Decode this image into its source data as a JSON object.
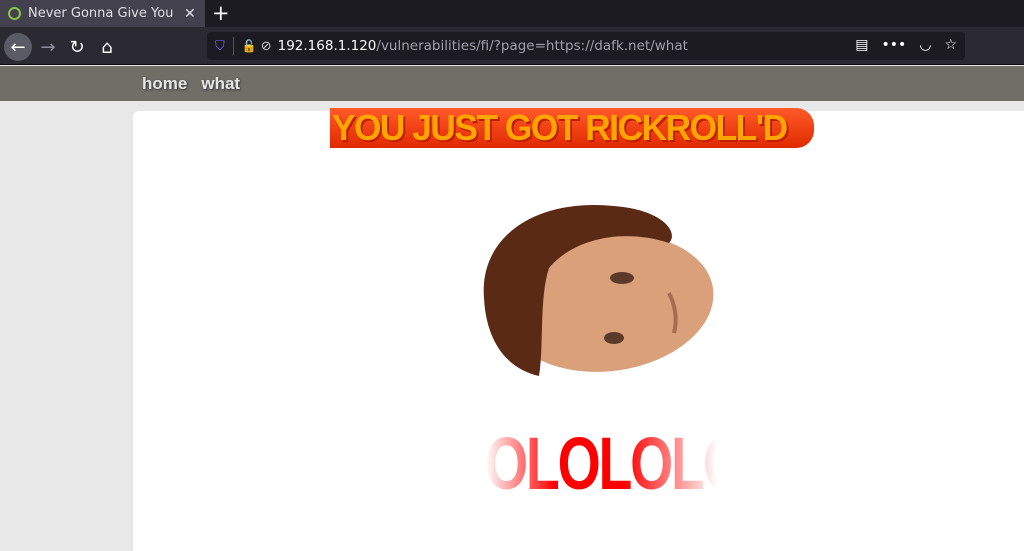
{
  "browser": {
    "tab_title": "Never Gonna Give You Up",
    "url_host": "192.168.1.120",
    "url_path": "/vulnerabilities/fi/?page=https://dafk.net/what"
  },
  "site_nav": {
    "items": [
      {
        "label": "home"
      },
      {
        "label": "what"
      }
    ]
  },
  "page": {
    "headline": "YOU JUST GOT RICKROLL'D",
    "footer_text": "OLOLOLOLO",
    "colors": {
      "headline_text": "#ffa500",
      "headline_bg": "#ff3b10",
      "lolo": "#ff0000"
    }
  }
}
